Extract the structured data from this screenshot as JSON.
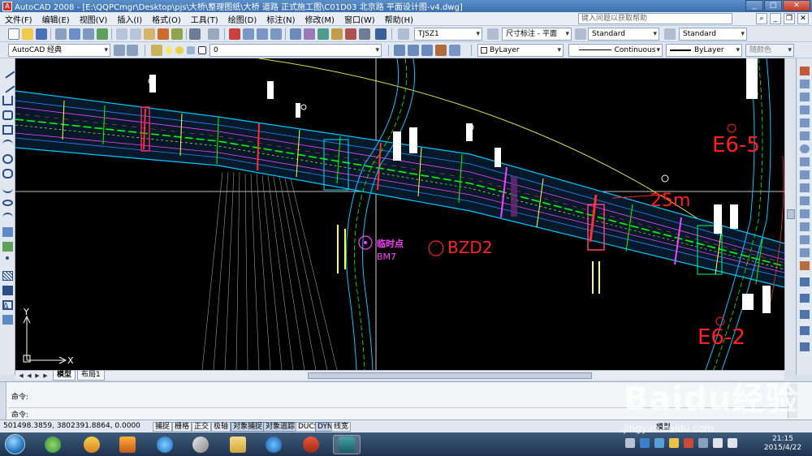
{
  "window": {
    "title": "AutoCAD 2008 - [E:\\QQPCmgr\\Desktop\\pjs\\大桥\\整理图纸\\大桥 道路 正式施工图\\C01D03 北京路 平面设计图-v4.dwg]",
    "app_icon_label": "A"
  },
  "menu": {
    "items": [
      "文件(F)",
      "编辑(E)",
      "视图(V)",
      "插入(I)",
      "格式(O)",
      "工具(T)",
      "绘图(D)",
      "标注(N)",
      "修改(M)",
      "窗口(W)",
      "帮助(H)"
    ],
    "help_placeholder": "键入问题以获取帮助"
  },
  "toolbar1": {
    "text_style": "TJSZ1",
    "dim_style": "尺寸标注 - 平面",
    "table_style": "Standard",
    "multileader_style": "Standard"
  },
  "toolbar2": {
    "workspace": "AutoCAD 经典",
    "layer": "0",
    "color": "ByLayer",
    "linetype": "Continuous",
    "lineweight": "ByLayer",
    "plotstyle": "随颜色"
  },
  "drawing": {
    "labels": {
      "survey_point": "临时点",
      "bm": "BM7",
      "bzd": "BZD2",
      "dimension": "25m",
      "e_top": "E6-5",
      "e_bottom": "E6-2",
      "ucs_y": "Y",
      "ucs_x": "X"
    }
  },
  "layout_tabs": [
    "模型",
    "布局1"
  ],
  "command": {
    "line1": "命令:",
    "line2": "命令:"
  },
  "status": {
    "coords": "501498.3859, 3802391.8864, 0.0000",
    "toggles": [
      "捕捉",
      "栅格",
      "正交",
      "极轴",
      "对象捕捉",
      "对象追踪",
      "DUCS",
      "DYN",
      "线宽"
    ],
    "right_label": "模型"
  },
  "taskbar": {
    "time": "21:15",
    "date": "2015/4/22"
  },
  "watermark": {
    "main": "Baidu经验",
    "sub": "jingyan.baidu.com"
  },
  "colors": {
    "drawing_bg": "#000000",
    "road_cyan": "#00c8ff",
    "centerline_green": "#00ff00",
    "magenta": "#ff00ff",
    "red": "#ff2020",
    "yellow": "#ffff40"
  }
}
